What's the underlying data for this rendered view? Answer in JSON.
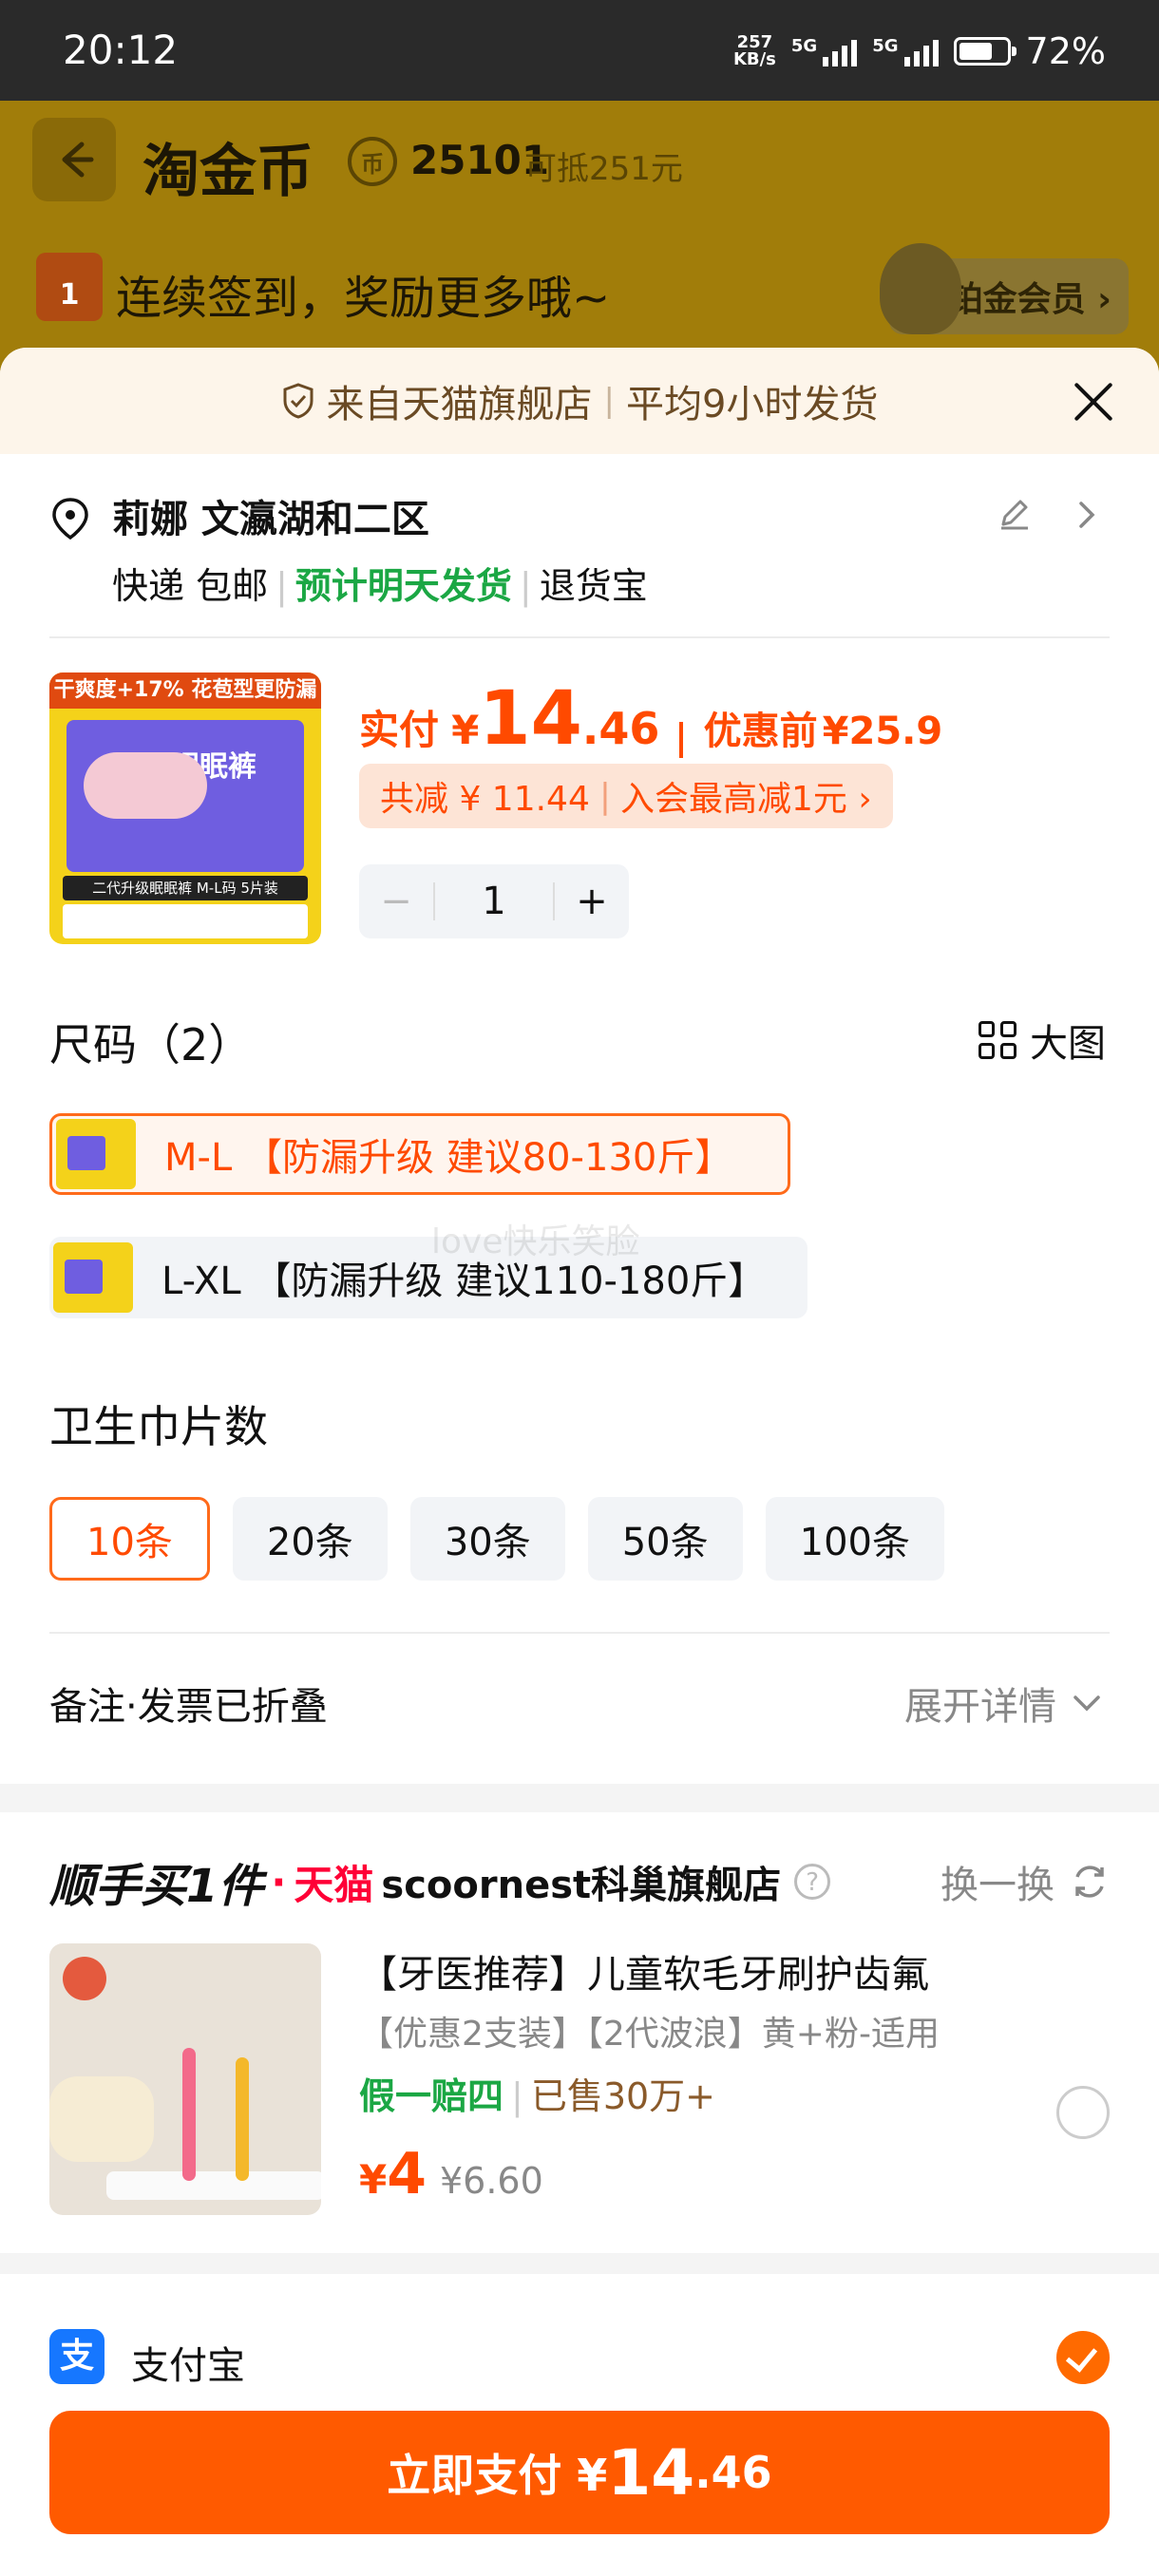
{
  "status_bar": {
    "time": "20:12",
    "net_speed_value": "257",
    "net_speed_unit": "KB/s",
    "signal1": "5G",
    "signal2": "5G",
    "battery": "72%",
    "battery_level": 0.72
  },
  "background_page": {
    "title": "淘金币",
    "coin_glyph": "币",
    "coins": "25101",
    "coins_sub": "可抵251元",
    "calendar_day": "1",
    "checkin_text": "连续签到，奖励更多哦~",
    "member_label": "铂金会员 ›"
  },
  "sheet": {
    "header": {
      "source": "来自天猫旗舰店",
      "ship_time": "平均9小时发货"
    },
    "address": {
      "name": "莉娜 文瀛湖和二区",
      "delivery": "快递 包邮",
      "estimate": "预计明天发货",
      "return": "退货宝"
    },
    "product": {
      "image_banner": "干爽度+17% 花苞型更防漏",
      "image_brand": "眠眠裤",
      "image_tag": "二代升级眠眠裤 M-L码 5片装",
      "price_label": "实付",
      "currency": "¥",
      "price_int": "14",
      "price_dec": ".46",
      "orig_label": "优惠前",
      "orig_price": "¥25.9",
      "savings": "共减 ¥ 11.44",
      "member_save": "入会最高减1元 ›",
      "quantity": "1",
      "minus": "−",
      "plus": "+"
    },
    "size": {
      "title": "尺码（2）",
      "big_view": "大图",
      "options": [
        {
          "label": "M-L 【防漏升级 建议80-130斤】",
          "selected": true
        },
        {
          "label": "L-XL 【防漏升级 建议110-180斤】",
          "selected": false
        }
      ]
    },
    "watermark": "love快乐笑脸",
    "count": {
      "title": "卫生巾片数",
      "options": [
        {
          "label": "10条",
          "selected": true
        },
        {
          "label": "20条",
          "selected": false
        },
        {
          "label": "30条",
          "selected": false
        },
        {
          "label": "50条",
          "selected": false
        },
        {
          "label": "100条",
          "selected": false
        }
      ]
    },
    "notes": {
      "label": "备注·发票已折叠",
      "expand": "展开详情"
    },
    "addon": {
      "title": "顺手买1件",
      "dot": "·",
      "tmall": "天猫",
      "shop": "scoornest科巢旗舰店",
      "help": "?",
      "swap": "换一换",
      "name": "【牙医推荐】儿童软毛牙刷护齿氟",
      "sub": "【优惠2支装】【2代波浪】黄+粉-适用",
      "guarantee": "假一赔四",
      "sold": "已售30万+",
      "currency": "¥",
      "price": "4",
      "old_price": "¥6.60"
    },
    "payment": {
      "icon_glyph": "支",
      "method": "支付宝",
      "button_label": "立即支付 ¥",
      "button_int": "14",
      "button_dec": ".46"
    }
  }
}
